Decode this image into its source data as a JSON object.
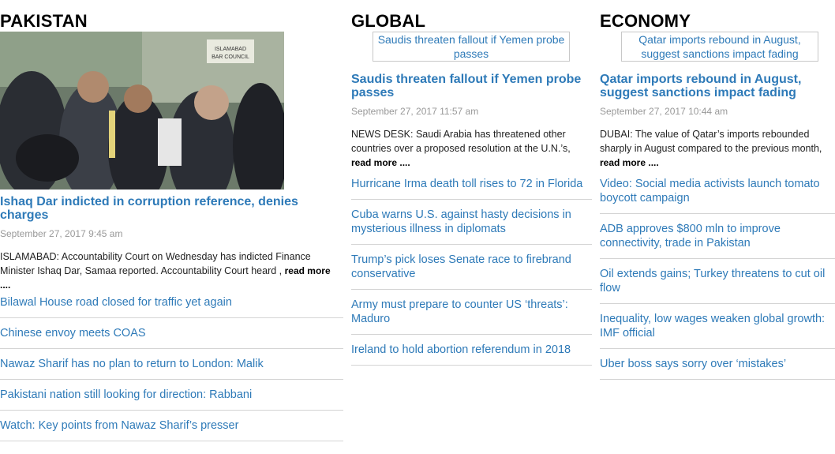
{
  "pakistan": {
    "section_title": "PAKISTAN",
    "photo_sign": "ISLAMABAD BAR COUNCIL",
    "lead": {
      "headline": "Ishaq Dar indicted in corruption reference, denies charges",
      "date": "September 27, 2017 9:45 am",
      "summary": "ISLAMABAD: Accountability Court on Wednesday has indicted Finance Minister Ishaq Dar, Samaa reported. Accountability Court heard ,",
      "read_more": "read more ...."
    },
    "links": [
      "Bilawal House road closed for traffic yet again",
      "Chinese envoy meets COAS",
      "Nawaz Sharif has no plan to return to London: Malik",
      "Pakistani nation still looking for direction: Rabbani",
      "Watch: Key points from Nawaz Sharif’s presser"
    ]
  },
  "global": {
    "section_title": "GLOBAL",
    "thumb_alt": "Saudis threaten fallout if Yemen probe passes",
    "lead": {
      "headline": "Saudis threaten fallout if Yemen probe passes",
      "date": "September 27, 2017 11:57 am",
      "summary": "NEWS DESK: Saudi Arabia has threatened other countries over a proposed resolution at the U.N.’s,",
      "read_more": "read more ...."
    },
    "links": [
      "Hurricane Irma death toll rises to 72 in Florida",
      "Cuba warns U.S. against hasty decisions in mysterious illness in diplomats",
      "Trump’s pick loses Senate race to firebrand conservative",
      "Army must prepare to counter US ‘threats’: Maduro",
      "Ireland to hold abortion referendum in 2018"
    ]
  },
  "economy": {
    "section_title": "ECONOMY",
    "thumb_alt": "Qatar imports rebound in August, suggest sanctions impact fading",
    "lead": {
      "headline": "Qatar imports rebound in August, suggest sanctions impact fading",
      "date": "September 27, 2017 10:44 am",
      "summary": "DUBAI: The value of Qatar’s imports rebounded sharply in August compared to the previous month,",
      "read_more": "read more ...."
    },
    "links": [
      "Video: Social media activists launch tomato boycott campaign",
      "ADB approves $800 mln to improve connectivity, trade in Pakistan",
      "Oil extends gains; Turkey threatens to cut oil flow",
      "Inequality, low wages weaken global growth: IMF official",
      "Uber boss says sorry over ‘mistakes’"
    ]
  }
}
